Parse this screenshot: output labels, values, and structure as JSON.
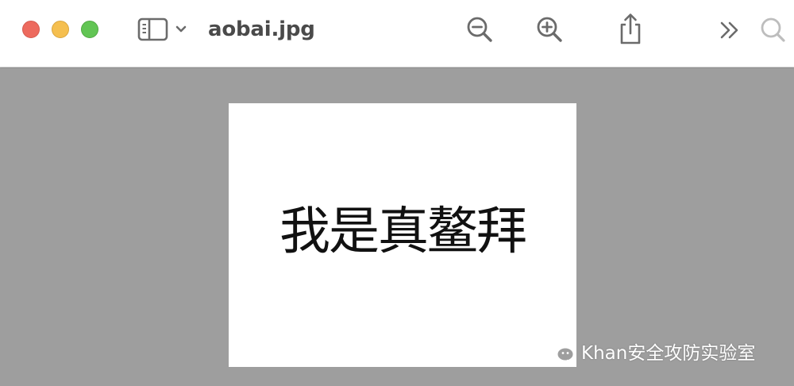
{
  "window": {
    "title": "aobai.jpg",
    "traffic_lights": {
      "close_color": "#ed6a5e",
      "minimize_color": "#f5bf4f",
      "maximize_color": "#62c554"
    }
  },
  "toolbar": {
    "sidebar_icon": "sidebar-toggle-icon",
    "chevron_icon": "chevron-down-icon",
    "zoom_out_icon": "zoom-out-icon",
    "zoom_in_icon": "zoom-in-icon",
    "share_icon": "share-icon",
    "more_icon": "double-chevron-right-icon",
    "search_icon": "search-icon"
  },
  "document": {
    "image_text": "我是真鳌拜"
  },
  "watermark": {
    "text": "Khan安全攻防实验室",
    "icon": "wechat-icon"
  },
  "colors": {
    "toolbar_bg": "#ffffff",
    "viewer_bg": "#9e9e9e",
    "icon_color": "#6b6b6b"
  }
}
